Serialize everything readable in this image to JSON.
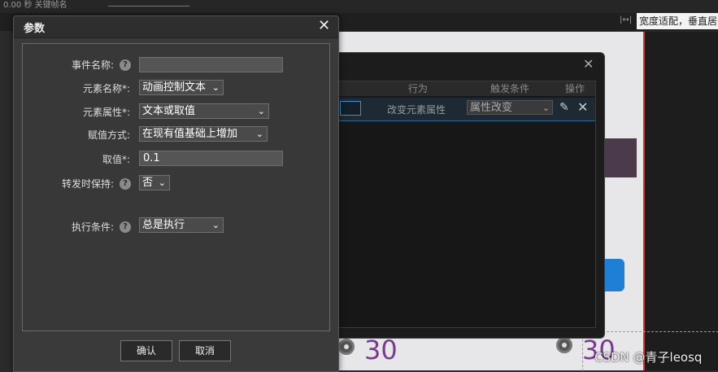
{
  "background": {
    "timeline_text": "0.00 秒    关键帧名",
    "fit_mode": "宽度适配，垂直居中",
    "numbers": [
      "30",
      "30"
    ],
    "accent_purple": "#7b3a8f",
    "accent_blue": "#1e7fd6"
  },
  "interaction_dialog": {
    "columns": [
      "行为",
      "触发条件",
      "操作"
    ],
    "row": {
      "action": "改变元素属性",
      "trigger": "属性改变"
    }
  },
  "params_dialog": {
    "title": "参数",
    "fields": {
      "event_name": {
        "label": "事件名称:",
        "value": ""
      },
      "element_name": {
        "label": "元素名称*:",
        "value": "动画控制文本"
      },
      "element_property": {
        "label": "元素属性*:",
        "value": "文本或取值"
      },
      "assign_mode": {
        "label": "赋值方式:",
        "value": "在现有值基础上增加"
      },
      "value": {
        "label": "取值*:",
        "value": "0.1"
      },
      "keep_on_forward": {
        "label": "转发时保持:",
        "value": "否"
      },
      "condition": {
        "label": "执行条件:",
        "value": "总是执行"
      }
    },
    "help_glyph": "?",
    "confirm_label": "确认",
    "cancel_label": "取消"
  },
  "watermark": "CSDN @青子leosq"
}
